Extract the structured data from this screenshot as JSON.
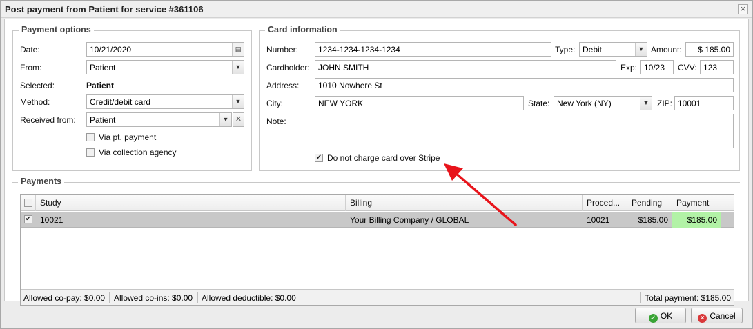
{
  "window": {
    "title": "Post payment from Patient for service #361106",
    "close_icon": "close-icon"
  },
  "payment_options": {
    "legend": "Payment options",
    "date_label": "Date:",
    "date_value": "10/21/2020",
    "from_label": "From:",
    "from_value": "Patient",
    "selected_label": "Selected:",
    "selected_value": "Patient",
    "method_label": "Method:",
    "method_value": "Credit/debit card",
    "received_label": "Received from:",
    "received_value": "Patient",
    "via_pt_payment": "Via pt. payment",
    "via_pt_payment_checked": false,
    "via_collection_agency": "Via collection agency",
    "via_collection_agency_checked": false
  },
  "card_information": {
    "legend": "Card information",
    "number_label": "Number:",
    "number_value": "1234-1234-1234-1234",
    "type_label": "Type:",
    "type_value": "Debit",
    "amount_label": "Amount:",
    "amount_value": "$ 185.00",
    "cardholder_label": "Cardholder:",
    "cardholder_value": "JOHN SMITH",
    "exp_label": "Exp:",
    "exp_value": "10/23",
    "cvv_label": "CVV:",
    "cvv_value": "123",
    "address_label": "Address:",
    "address_value": "1010 Nowhere St",
    "city_label": "City:",
    "city_value": "NEW YORK",
    "state_label": "State:",
    "state_value": "New York (NY)",
    "zip_label": "ZIP:",
    "zip_value": "10001",
    "note_label": "Note:",
    "note_value": "",
    "no_charge_label": "Do not charge card over Stripe",
    "no_charge_checked": true
  },
  "payments": {
    "legend": "Payments",
    "columns": [
      "Study",
      "Billing",
      "Proced...",
      "Pending",
      "Payment"
    ],
    "rows": [
      {
        "checked": true,
        "study": "10021",
        "billing": "Your Billing Company / GLOBAL",
        "procedure": "10021",
        "pending": "$185.00",
        "payment": "$185.00"
      }
    ],
    "footer": {
      "copay": "Allowed co-pay: $0.00",
      "coins": "Allowed co-ins: $0.00",
      "deductible": "Allowed deductible: $0.00",
      "total": "Total payment: $185.00"
    }
  },
  "buttons": {
    "ok": "OK",
    "cancel": "Cancel"
  },
  "colors": {
    "payment_cell": "#b2f2a6",
    "selected_row": "#c8c8c8",
    "arrow": "#e8141b",
    "ok_icon": "#3aa436",
    "cancel_icon": "#d9383a"
  }
}
